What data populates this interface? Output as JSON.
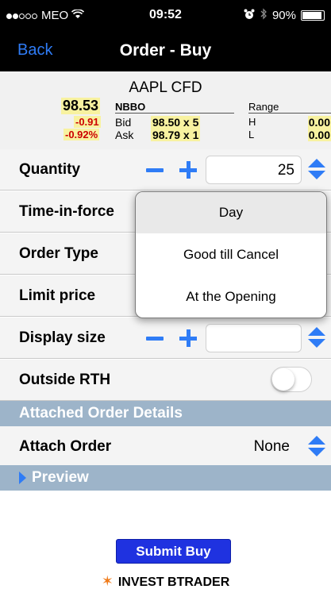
{
  "status_bar": {
    "carrier": "MEO",
    "time": "09:52",
    "battery": "90%",
    "signal_bars_filled": 2,
    "signal_bars_total": 5,
    "icons": [
      "wifi-icon",
      "alarm-icon",
      "bluetooth-icon",
      "battery-icon"
    ]
  },
  "nav": {
    "back_label": "Back",
    "title": "Order - Buy",
    "back_color": "#2f7cf6"
  },
  "quote": {
    "symbol": "AAPL CFD",
    "last": "98.53",
    "change": "-0.91",
    "change_pct": "-0.92%",
    "nbbo_label": "NBBO",
    "range_label": "Range",
    "bid_label": "Bid",
    "ask_label": "Ask",
    "bid": "98.50 x 5",
    "ask": "98.79 x 1",
    "high_label": "H",
    "low_label": "L",
    "high": "0.00",
    "low": "0.00",
    "highlight_color": "#f8f2a0",
    "negative_color": "#cc0000"
  },
  "form": {
    "quantity_label": "Quantity",
    "quantity_value": "25",
    "tif_label": "Time-in-force",
    "order_type_label": "Order Type",
    "limit_price_label": "Limit price",
    "display_size_label": "Display size",
    "display_size_value": "",
    "outside_rth_label": "Outside RTH",
    "outside_rth_on": false,
    "attached_section": "Attached Order Details",
    "attach_order_label": "Attach Order",
    "attach_order_value": "None",
    "preview_label": "Preview",
    "accent_color": "#2f7cf6",
    "section_color": "#9db4c9"
  },
  "tif_popup": {
    "options": [
      "Day",
      "Good till Cancel",
      "At the Opening"
    ],
    "selected": "Day"
  },
  "footer": {
    "submit_label": "Submit Buy",
    "brand": "INVEST BTRADER",
    "submit_color": "#1f32e0"
  }
}
